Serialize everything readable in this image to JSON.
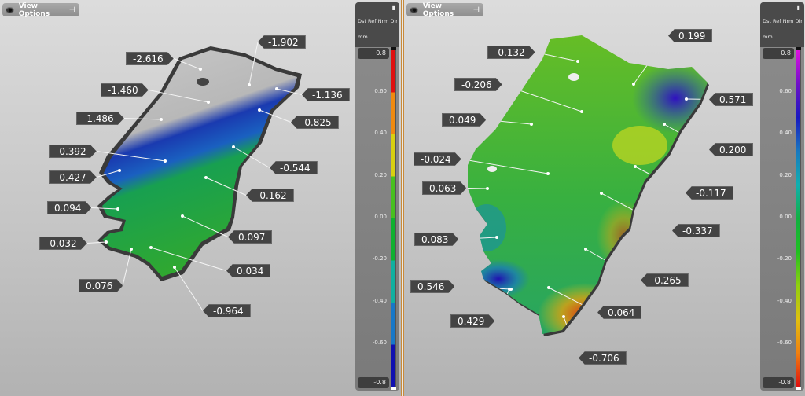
{
  "left_view": {
    "view_options_label": "View Options",
    "legend": {
      "type": "Dst Ref Nrm Dir",
      "unit": "mm",
      "max": "0.8",
      "min": "-0.8",
      "ticks": [
        "0.60",
        "0.40",
        "0.20",
        "0.00",
        "-0.20",
        "-0.40",
        "-0.60"
      ],
      "colors": [
        "#e01010",
        "#f08a10",
        "#d8d010",
        "#48c020",
        "#10b030",
        "#10b0a0",
        "#1878c8",
        "#1010b0"
      ]
    },
    "callouts": [
      "-2.616",
      "-1.902",
      "-1.460",
      "-1.136",
      "-1.486",
      "-0.825",
      "-0.392",
      "-0.544",
      "-0.427",
      "-0.162",
      "0.094",
      "0.097",
      "-0.032",
      "0.034",
      "0.076",
      "-0.964"
    ]
  },
  "right_view": {
    "view_options_label": "View Options",
    "legend": {
      "type": "Dst Ref Nrm Dir",
      "unit": "mm",
      "max": "0.8",
      "min": "-0.8",
      "ticks": [
        "0.60",
        "0.40",
        "0.20",
        "0.00",
        "-0.20",
        "-0.40",
        "-0.60"
      ],
      "colors": [
        "#e010e0",
        "#7010c8",
        "#1818c0",
        "#1878c0",
        "#10b0b0",
        "#10b040",
        "#20c020",
        "#90d010",
        "#e0c010",
        "#f08010",
        "#e01010"
      ]
    },
    "callouts": [
      "-0.132",
      "0.199",
      "-0.206",
      "0.571",
      "0.049",
      "0.200",
      "-0.024",
      "-0.117",
      "0.063",
      "-0.337",
      "0.083",
      "-0.265",
      "0.546",
      "0.064",
      "0.429",
      "-0.706"
    ]
  }
}
